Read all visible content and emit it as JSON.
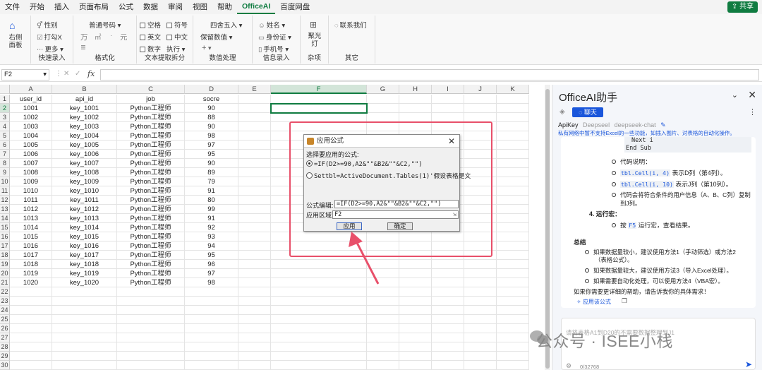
{
  "menu": [
    "文件",
    "开始",
    "插入",
    "页面布局",
    "公式",
    "数据",
    "审阅",
    "视图",
    "帮助",
    "OfficeAI",
    "百度网盘"
  ],
  "share_label": "共享",
  "ribbon": {
    "right_panel": "右侧面板",
    "quick_input": {
      "gender": "性别",
      "hit_x": "打勾X",
      "more": "更多",
      "label": "快速录入"
    },
    "format": {
      "normal_number": "普通号码",
      "wan": "万",
      "sq": "㎡",
      "yuan": "元",
      "label": "格式化"
    },
    "text_extract": {
      "space": "空格",
      "symbol": "符号",
      "english": "英文",
      "chinese": "中文",
      "digit": "数字",
      "execute": "执行",
      "label": "文本提取拆分"
    },
    "number_proc": {
      "round": "四舍五入",
      "keep_num": "保留数值",
      "plus": "+",
      "label": "数值处理"
    },
    "info_input": {
      "name": "姓名",
      "id_card": "身份证",
      "phone": "手机号",
      "label": "信息录入"
    },
    "misc": {
      "spotlight": "聚光灯",
      "label": "杂项"
    },
    "other": {
      "contact": "联系我们",
      "label": "其它"
    }
  },
  "formula_bar": {
    "name_box": "F2",
    "fx": "fx"
  },
  "sheet": {
    "columns": [
      "A",
      "B",
      "C",
      "D",
      "E",
      "F",
      "G",
      "H",
      "I",
      "J",
      "K"
    ],
    "selected_col": "F",
    "headers": [
      "user_id",
      "api_id",
      "job",
      "socre"
    ],
    "rows": [
      [
        "1001",
        "key_1001",
        "Python工程师",
        "90"
      ],
      [
        "1002",
        "key_1002",
        "Python工程师",
        "88"
      ],
      [
        "1003",
        "key_1003",
        "Python工程师",
        "90"
      ],
      [
        "1004",
        "key_1004",
        "Python工程师",
        "98"
      ],
      [
        "1005",
        "key_1005",
        "Python工程师",
        "97"
      ],
      [
        "1006",
        "key_1006",
        "Python工程师",
        "95"
      ],
      [
        "1007",
        "key_1007",
        "Python工程师",
        "90"
      ],
      [
        "1008",
        "key_1008",
        "Python工程师",
        "89"
      ],
      [
        "1009",
        "key_1009",
        "Python工程师",
        "79"
      ],
      [
        "1010",
        "key_1010",
        "Python工程师",
        "91"
      ],
      [
        "1011",
        "key_1011",
        "Python工程师",
        "80"
      ],
      [
        "1012",
        "key_1012",
        "Python工程师",
        "99"
      ],
      [
        "1013",
        "key_1013",
        "Python工程师",
        "91"
      ],
      [
        "1014",
        "key_1014",
        "Python工程师",
        "92"
      ],
      [
        "1015",
        "key_1015",
        "Python工程师",
        "93"
      ],
      [
        "1016",
        "key_1016",
        "Python工程师",
        "94"
      ],
      [
        "1017",
        "key_1017",
        "Python工程师",
        "95"
      ],
      [
        "1018",
        "key_1018",
        "Python工程师",
        "96"
      ],
      [
        "1019",
        "key_1019",
        "Python工程师",
        "97"
      ],
      [
        "1020",
        "key_1020",
        "Python工程师",
        "98"
      ]
    ],
    "row_count": 30
  },
  "dialog": {
    "title": "应用公式",
    "prompt": "选择要应用的公式:",
    "option1": "=IF(D2>=90,A2&\"\"&B2&\"\"&C2,\"\")",
    "option2": "Settbl=ActiveDocument.Tables(1)'假设表格是文",
    "formula_label": "公式编辑:",
    "formula_value": "=IF(D2>=90,A2&\"\"&B2&\"\"&C2,\"\")",
    "range_label": "应用区域",
    "range_value": "F2",
    "apply_button": "应用",
    "ok_button": "确定"
  },
  "panel": {
    "title": "OfficeAI助手",
    "chat_tab": "聊天",
    "tabs": [
      "ApiKey",
      "Deepseel",
      "deepseek-chat"
    ],
    "note": "私有网络中暂不支持Excel的一些功能，如插入图片、对表格的自动化操作。",
    "code_lines": [
      "Next i",
      "End Sub"
    ],
    "items": [
      {
        "text": "代码说明："
      },
      {
        "code": "tbl.Cell(i, 4)",
        "text": "表示D列（第4列）。"
      },
      {
        "code": "tbl.Cell(i, 10)",
        "text": "表示J列（第10列）。"
      },
      {
        "text": "代码会将符合条件的用户信息（A、B、C列）复制"
      },
      {
        "text": "到J列。"
      }
    ],
    "step4": "4.  运行宏：",
    "step4_item": {
      "pre": "按",
      "code": "F5",
      "post": "运行宏，查看结果。"
    },
    "summary": "总结",
    "summary_items": [
      "如果数据量较小，建议使用方法1（手动筛选）或方法2",
      "（表格公式）。",
      "如果数据量较大，建议使用方法3（导入Excel处理）。",
      "如果需要自动化处理，可以使用方法4（VBA宏）。"
    ],
    "closing": "如果你需要更详细的帮助，请告诉我你的具体需求！",
    "apply_formula": "应用该公式",
    "input_placeholder": "请将表格A1到D20的不需要数据整理到J1",
    "char_count": "0/32768"
  },
  "watermark": "公众号 · ISEE小栈",
  "colors": {
    "excel_green": "#107c41",
    "highlight_red": "#e8506a",
    "ai_blue": "#1a56db"
  }
}
